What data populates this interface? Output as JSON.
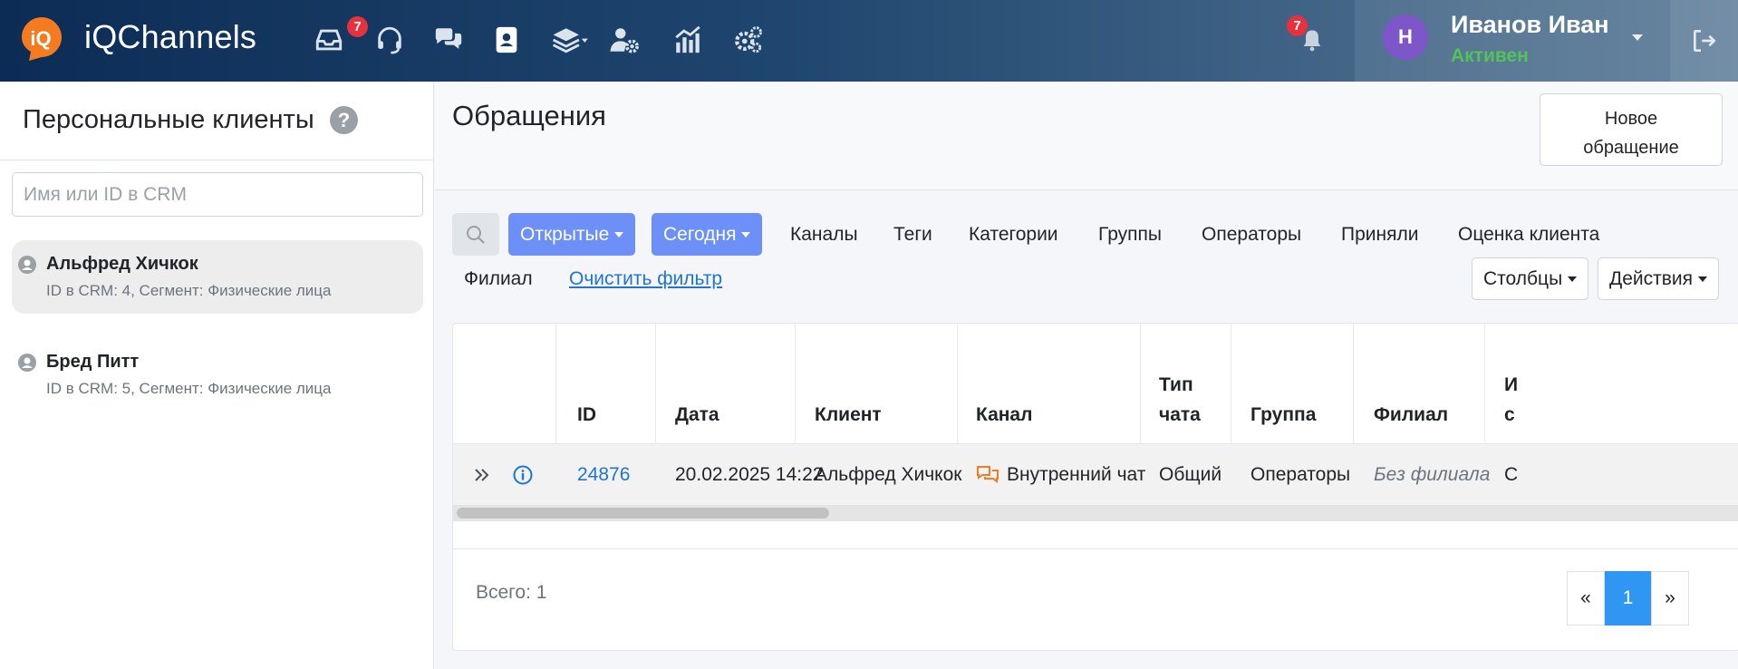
{
  "app": {
    "name": "iQChannels",
    "logo_text": "iQ",
    "accent": "#f47b20"
  },
  "nav": {
    "items": [
      {
        "icon": "inbox-icon",
        "badge": "7"
      },
      {
        "icon": "headset-icon"
      },
      {
        "icon": "chat-bubbles-icon"
      },
      {
        "icon": "contacts-icon"
      },
      {
        "icon": "layers-icon"
      },
      {
        "icon": "users-gear-icon"
      },
      {
        "icon": "analytics-icon"
      },
      {
        "icon": "settings-gears-icon"
      }
    ],
    "notifications_badge": "7"
  },
  "user": {
    "initial": "Н",
    "name": "Иванов Иван",
    "status": "Активен"
  },
  "sidebar": {
    "title": "Персональные клиенты",
    "search_placeholder": "Имя или ID в CRM",
    "clients": [
      {
        "name": "Альфред Хичкок",
        "details": "ID в CRM: 4, Сегмент: Физические лица",
        "active": true
      },
      {
        "name": "Бред Питт",
        "details": "ID в CRM: 5, Сегмент: Физические лица",
        "active": false
      }
    ]
  },
  "main": {
    "title": "Обращения",
    "new_button_line1": "Новое",
    "new_button_line2": "обращение"
  },
  "filters": {
    "open": "Открытые",
    "today": "Сегодня",
    "links": [
      "Каналы",
      "Теги",
      "Категории",
      "Группы",
      "Операторы",
      "Приняли",
      "Оценка клиента",
      "Филиал"
    ],
    "clear": "Очистить фильтр",
    "columns": "Столбцы",
    "actions": "Действия"
  },
  "table": {
    "headers": [
      "ID",
      "Дата",
      "Клиент",
      "Канал",
      "Тип чата",
      "Группа",
      "Филиал",
      "И с"
    ],
    "rows": [
      {
        "id": "24876",
        "date": "20.02.2025 14:22",
        "client": "Альфред Хичкок",
        "channel": "Внутренний чат",
        "chat_type": "Общий",
        "group": "Операторы",
        "branch": "Без филиала",
        "extra": "С"
      }
    ]
  },
  "footer": {
    "total": "Всего: 1",
    "pages": [
      "«",
      "1",
      "»"
    ],
    "current_page": "1"
  }
}
